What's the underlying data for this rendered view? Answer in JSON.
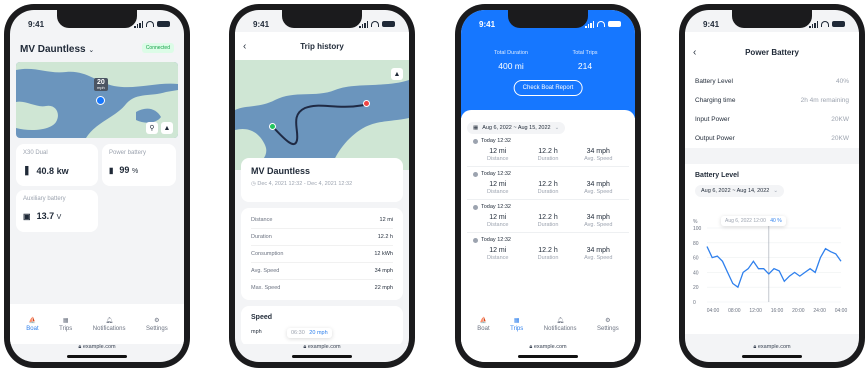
{
  "status_time": "9:41",
  "url": "example.com",
  "tabs": [
    {
      "label": "Boat",
      "icon": "boat-icon"
    },
    {
      "label": "Trips",
      "icon": "map-icon"
    },
    {
      "label": "Notifications",
      "icon": "bell-icon"
    },
    {
      "label": "Settings",
      "icon": "gear-icon"
    }
  ],
  "colors": {
    "accent": "#2f80ed",
    "blue_header": "#1677ff",
    "connected_bg": "#dcfce7",
    "connected_text": "#16a34a",
    "chart_line": "#2f80ed"
  },
  "boat": {
    "title": "MV Dauntless",
    "status": "Connected",
    "map_marker_value": "20",
    "map_marker_unit": "mph",
    "stats": {
      "engine": {
        "label": "X30 Dual",
        "value": "40.8 kw",
        "icon": "engine-icon"
      },
      "power": {
        "label": "Power battery",
        "value": "99",
        "unit": "%",
        "icon": "battery-icon"
      },
      "aux": {
        "label": "Auxiliary battery",
        "value": "13.7",
        "unit": "V",
        "icon": "aux-battery-icon"
      }
    }
  },
  "history": {
    "header": "Trip history",
    "boat_name": "MV Dauntless",
    "date_range": "Dec 4, 2021 12:32 - Dec 4, 2021 12:32",
    "rows": [
      {
        "label": "Distance",
        "value": "12 mi"
      },
      {
        "label": "Duration",
        "value": "12.2 h"
      },
      {
        "label": "Consumption",
        "value": "12 kWh"
      },
      {
        "label": "Avg. Speed",
        "value": "34 mph"
      },
      {
        "label": "Max. Speed",
        "value": "22 mph"
      }
    ],
    "speed_title": "Speed",
    "speed_unit": "mph",
    "tooltip_time": "06:30",
    "tooltip_value": "20 mph"
  },
  "trips": {
    "total_duration_label": "Total Duration",
    "total_duration_value": "400 mi",
    "total_trips_label": "Total Trips",
    "total_trips_value": "214",
    "report_button": "Check Boat Report",
    "date_range": "Aug 6, 2022  ~  Aug 15, 2022",
    "items": [
      {
        "when": "Today 12:32",
        "distance": "12 mi",
        "duration": "12.2 h",
        "speed": "34 mph"
      },
      {
        "when": "Today 12:32",
        "distance": "12 mi",
        "duration": "12.2 h",
        "speed": "34 mph"
      },
      {
        "when": "Today 12:32",
        "distance": "12 mi",
        "duration": "12.2 h",
        "speed": "34 mph"
      },
      {
        "when": "Today 12:32",
        "distance": "12 mi",
        "duration": "12.2 h",
        "speed": "34 mph"
      }
    ],
    "col_labels": {
      "distance": "Distance",
      "duration": "Duration",
      "speed": "Avg. Speed"
    }
  },
  "power": {
    "header": "Power Battery",
    "rows": [
      {
        "label": "Battery Level",
        "value": "40%"
      },
      {
        "label": "Charging time",
        "value": "2h 4m remaining"
      },
      {
        "label": "Input Power",
        "value": "20KW"
      },
      {
        "label": "Output Power",
        "value": "20KW"
      }
    ],
    "chart_title": "Battery Level",
    "date_range": "Aug 6, 2022  ~  Aug 14, 2022",
    "tooltip_time": "Aug 6, 2022 12:00",
    "tooltip_value": "40 %"
  },
  "chart_data": {
    "type": "line",
    "title": "Battery Level",
    "ylabel": "%",
    "ylim": [
      0,
      100
    ],
    "yticks": [
      "100",
      "80",
      "60",
      "40",
      "20",
      "0"
    ],
    "categories": [
      "04:00",
      "08:00",
      "12:00",
      "16:00",
      "20:00",
      "24:00",
      "04:00"
    ],
    "x": [
      0,
      0.5,
      1,
      1.5,
      2,
      2.5,
      3,
      3.5,
      4,
      4.5,
      5,
      5.5,
      6,
      6.5,
      7,
      7.5,
      8,
      8.5,
      9,
      9.5,
      10,
      10.5,
      11,
      11.5,
      12,
      12.5,
      13
    ],
    "values": [
      75,
      60,
      62,
      55,
      40,
      25,
      20,
      40,
      45,
      55,
      45,
      45,
      38,
      45,
      42,
      28,
      35,
      40,
      35,
      40,
      45,
      40,
      60,
      72,
      68,
      65,
      55
    ],
    "grid": true
  }
}
